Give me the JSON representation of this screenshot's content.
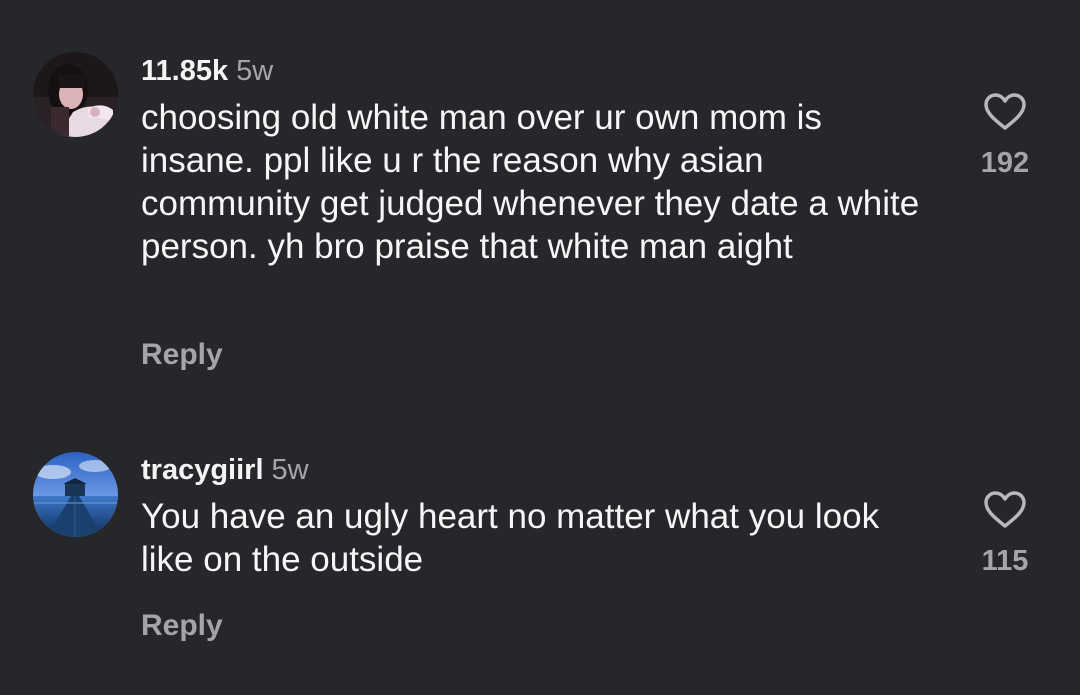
{
  "comments": [
    {
      "username": "11.85k",
      "time": "5w",
      "text": "choosing old white man over ur own mom is insane. ppl like u r the reason why asian community get judged whenever they date a white person. yh bro praise that white man aight",
      "reply_label": "Reply",
      "likes": "192",
      "avatar_icon": "avatar-photo-girl"
    },
    {
      "username": "tracygiirl",
      "time": "5w",
      "text": "You have an ugly heart no matter what you look like on the outside",
      "reply_label": "Reply",
      "likes": "115",
      "avatar_icon": "avatar-photo-pier"
    }
  ],
  "icons": {
    "like": "heart-outline-icon"
  },
  "colors": {
    "background": "#26272b",
    "primary_text": "#f6f6f6",
    "secondary_text": "#a3a5ab"
  }
}
